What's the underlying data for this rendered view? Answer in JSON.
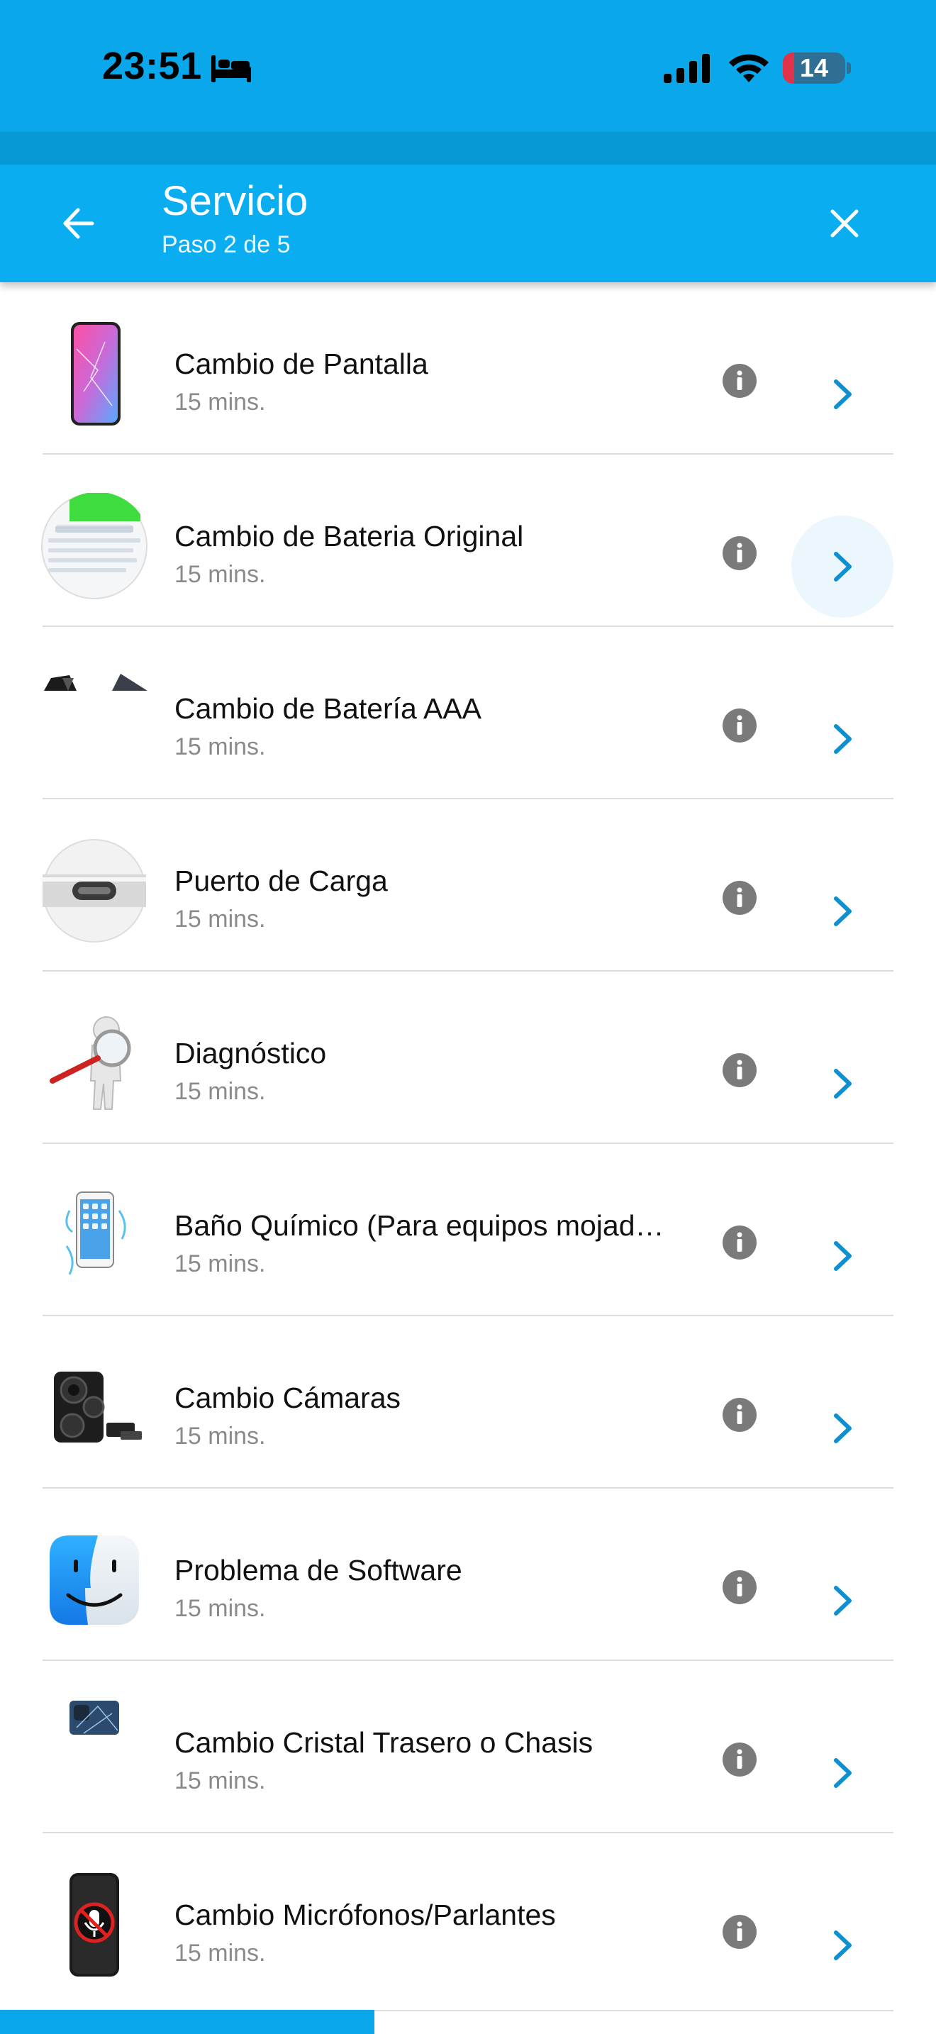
{
  "status_bar": {
    "time": "23:51",
    "battery": "14",
    "icons": [
      "bed-icon",
      "signal-icon",
      "wifi-icon",
      "battery-icon"
    ]
  },
  "header": {
    "title": "Servicio",
    "subtitle": "Paso 2 de 5",
    "back_icon": "arrow-left-icon",
    "close_icon": "close-icon"
  },
  "colors": {
    "primary": "#0aaef0",
    "status_bar": "#0aa8ea",
    "chevron": "#0d8fd0",
    "info_icon": "#7a7a7a",
    "subtitle_text": "#8a8a8a"
  },
  "services": [
    {
      "title": "Cambio de Pantalla",
      "duration": "15 mins.",
      "thumb": "phone-screen-icon"
    },
    {
      "title": "Cambio de Bateria Original",
      "duration": "15 mins.",
      "thumb": "battery-health-icon"
    },
    {
      "title": "Cambio de Batería AAA",
      "duration": "15 mins.",
      "thumb": "battery-parts-icon"
    },
    {
      "title": "Puerto de Carga",
      "duration": "15 mins.",
      "thumb": "charging-port-icon"
    },
    {
      "title": "Diagnóstico",
      "duration": "15 mins.",
      "thumb": "magnifier-figure-icon"
    },
    {
      "title": "Baño Químico (Para equipos mojad…",
      "duration": "15 mins.",
      "thumb": "wet-phone-icon"
    },
    {
      "title": "Cambio Cámaras",
      "duration": "15 mins.",
      "thumb": "camera-module-icon"
    },
    {
      "title": "Problema de Software",
      "duration": "15 mins.",
      "thumb": "finder-face-icon"
    },
    {
      "title": "Cambio Cristal Trasero o Chasis",
      "duration": "15 mins.",
      "thumb": "back-glass-icon"
    },
    {
      "title": "Cambio Micrófonos/Parlantes",
      "duration": "15 mins.",
      "thumb": "microphone-phone-icon"
    }
  ],
  "progress": {
    "step": 2,
    "total": 5,
    "fraction": 0.4
  }
}
